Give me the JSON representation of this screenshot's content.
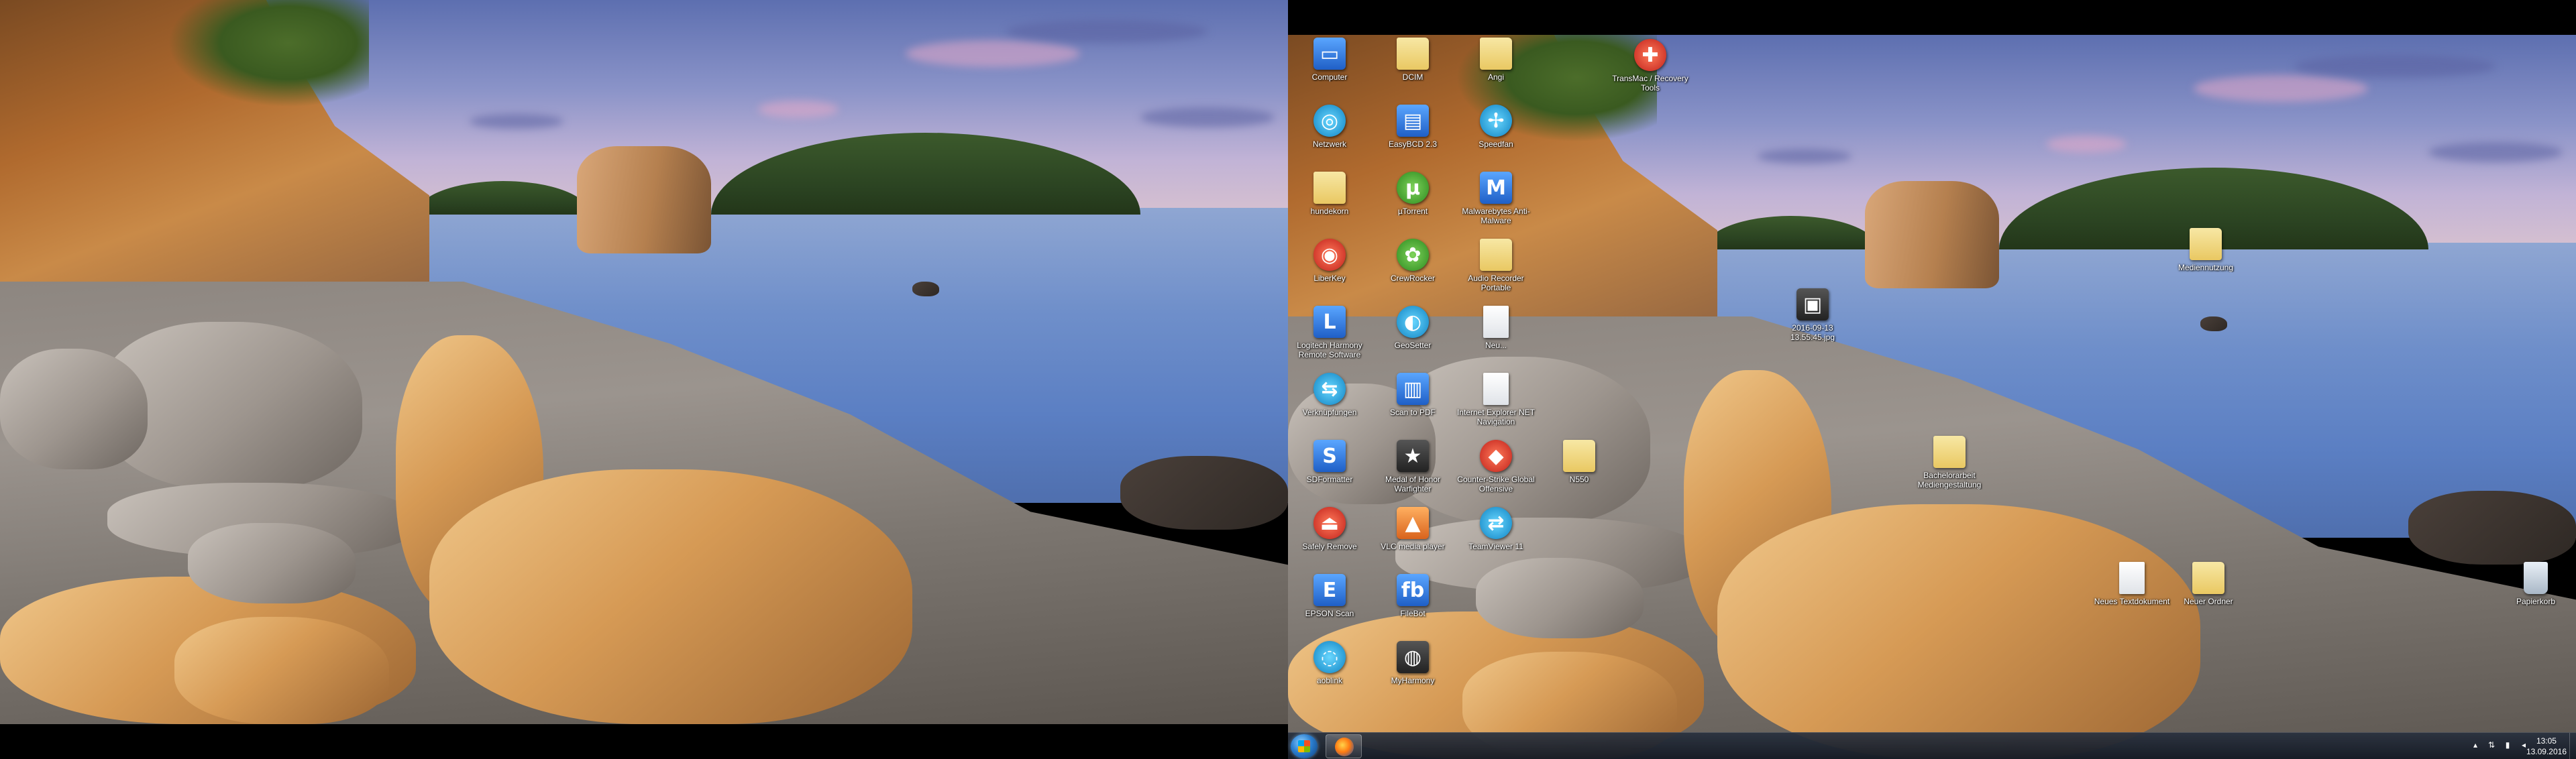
{
  "desktop": {
    "icons": [
      {
        "label": "Computer",
        "kind": "blue",
        "glyph": "▭"
      },
      {
        "label": "DCIM",
        "kind": "folder",
        "glyph": ""
      },
      {
        "label": "Angi",
        "kind": "folder",
        "glyph": ""
      },
      {
        "label": "TransMac / Recovery Tools",
        "kind": "red",
        "glyph": "✚"
      },
      {
        "label": "Netzwerk",
        "kind": "teal",
        "glyph": "◎"
      },
      {
        "label": "EasyBCD 2.3",
        "kind": "blue",
        "glyph": "▤"
      },
      {
        "label": "Speedfan",
        "kind": "teal",
        "glyph": "✢"
      },
      {
        "label": "hundekorn",
        "kind": "folder",
        "glyph": ""
      },
      {
        "label": "µTorrent",
        "kind": "green",
        "glyph": "µ"
      },
      {
        "label": "Malwarebytes Anti-Malware",
        "kind": "blue",
        "glyph": "M"
      },
      {
        "label": "LiberKey",
        "kind": "red",
        "glyph": "◉"
      },
      {
        "label": "CrewRocker",
        "kind": "green",
        "glyph": "✿"
      },
      {
        "label": "Audio Recorder Portable",
        "kind": "folder",
        "glyph": ""
      },
      {
        "label": "Logitech Harmony Remote Software",
        "kind": "blue",
        "glyph": "L"
      },
      {
        "label": "GeoSetter",
        "kind": "teal",
        "glyph": "◐"
      },
      {
        "label": "Neu...",
        "kind": "file",
        "glyph": ""
      },
      {
        "label": "2016-09-13 13.55.45.jpg",
        "kind": "dark",
        "glyph": "▣"
      },
      {
        "label": "Verknüpfungen",
        "kind": "teal",
        "glyph": "⇆"
      },
      {
        "label": "Scan to PDF",
        "kind": "blue",
        "glyph": "▥"
      },
      {
        "label": "Internet Explorer NET Navigation",
        "kind": "file",
        "glyph": ""
      },
      {
        "label": "SDFormatter",
        "kind": "blue",
        "glyph": "S"
      },
      {
        "label": "Medal of Honor Warfighter",
        "kind": "dark",
        "glyph": "★"
      },
      {
        "label": "Counter-Strike Global Offensive",
        "kind": "red",
        "glyph": "◆"
      },
      {
        "label": "N550",
        "kind": "folder",
        "glyph": ""
      },
      {
        "label": "Safely Remove",
        "kind": "red",
        "glyph": "⏏"
      },
      {
        "label": "VLC media player",
        "kind": "orange",
        "glyph": "▲"
      },
      {
        "label": "TeamViewer 11",
        "kind": "teal",
        "glyph": "⇄"
      },
      {
        "label": "Bachelorarbeit Mediengestaltung",
        "kind": "folder",
        "glyph": ""
      },
      {
        "label": "Mediennutzung",
        "kind": "folder",
        "glyph": ""
      },
      {
        "label": "EPSON Scan",
        "kind": "blue",
        "glyph": "E"
      },
      {
        "label": "FileBot",
        "kind": "blue",
        "glyph": "fb"
      },
      {
        "label": "Neues Textdokument",
        "kind": "file",
        "glyph": ""
      },
      {
        "label": "Neuer Ordner",
        "kind": "folder",
        "glyph": ""
      },
      {
        "label": "Papierkorb",
        "kind": "bin",
        "glyph": ""
      },
      {
        "label": "aoblink",
        "kind": "teal",
        "glyph": "◌"
      },
      {
        "label": "MyHarmony",
        "kind": "dark",
        "glyph": "◍"
      }
    ]
  },
  "taskbar": {
    "start_label": "Start",
    "pinned": [
      {
        "name": "Firefox"
      }
    ],
    "tray": {
      "icons": [
        "▴",
        "⇅",
        "▮",
        "◂"
      ]
    },
    "clock": {
      "time": "13:05",
      "date": "13.09.2016"
    }
  }
}
